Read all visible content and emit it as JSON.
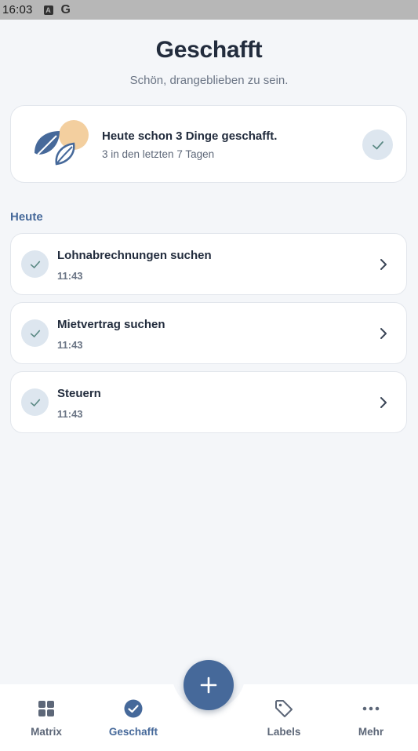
{
  "status_bar": {
    "time": "16:03",
    "icons": [
      "a-icon",
      "google-icon"
    ]
  },
  "header": {
    "title": "Geschafft",
    "subtitle": "Schön, drangeblieben zu sein."
  },
  "summary": {
    "title": "Heute schon 3 Dinge geschafft.",
    "subtitle": "3 in den letzten 7 Tagen"
  },
  "section": {
    "label": "Heute"
  },
  "tasks": [
    {
      "title": "Lohnabrechnungen suchen",
      "time": "11:43"
    },
    {
      "title": "Mietvertrag suchen",
      "time": "11:43"
    },
    {
      "title": "Steuern",
      "time": "11:43"
    }
  ],
  "nav": {
    "items": [
      {
        "label": "Matrix",
        "icon": "grid-icon",
        "active": false
      },
      {
        "label": "Geschafft",
        "icon": "check-circle-icon",
        "active": true
      },
      {
        "label": "Labels",
        "icon": "tag-icon",
        "active": false
      },
      {
        "label": "Mehr",
        "icon": "more-icon",
        "active": false
      }
    ]
  },
  "colors": {
    "accent": "#46699a",
    "check_bg": "#dde6ef",
    "check_stroke": "#5c8a85",
    "sun": "#f3cf9f",
    "background": "#f4f6f9"
  }
}
